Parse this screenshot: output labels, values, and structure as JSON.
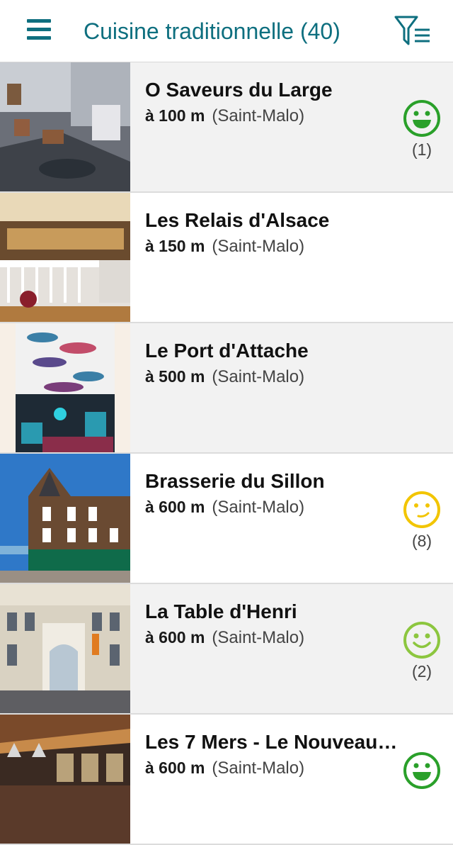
{
  "header": {
    "title": "Cuisine traditionnelle (40)",
    "menu_icon": "hamburger-menu-icon",
    "filter_icon": "filter-list-icon",
    "accent_color": "#0e6f7f"
  },
  "restaurants": [
    {
      "name": "O Saveurs du Large",
      "distance": "à 100 m",
      "city": "(Saint-Malo)",
      "rating_icon": "big-smile-icon",
      "rating_color": "#2aa02a",
      "rating_count": "(1)"
    },
    {
      "name": "Les Relais d'Alsace",
      "distance": "à 150 m",
      "city": "(Saint-Malo)"
    },
    {
      "name": "Le Port d'Attache",
      "distance": "à 500 m",
      "city": "(Saint-Malo)"
    },
    {
      "name": "Brasserie du Sillon",
      "distance": "à 600 m",
      "city": "(Saint-Malo)",
      "rating_icon": "neutral-smile-icon",
      "rating_color": "#f2c500",
      "rating_count": "(8)"
    },
    {
      "name": "La Table d'Henri",
      "distance": "à 600 m",
      "city": "(Saint-Malo)",
      "rating_icon": "smile-icon",
      "rating_color": "#8cc63f",
      "rating_count": "(2)"
    },
    {
      "name": "Les 7 Mers - Le Nouveau…",
      "distance": "à 600 m",
      "city": "(Saint-Malo)",
      "rating_icon": "big-smile-icon",
      "rating_color": "#2aa02a"
    }
  ]
}
